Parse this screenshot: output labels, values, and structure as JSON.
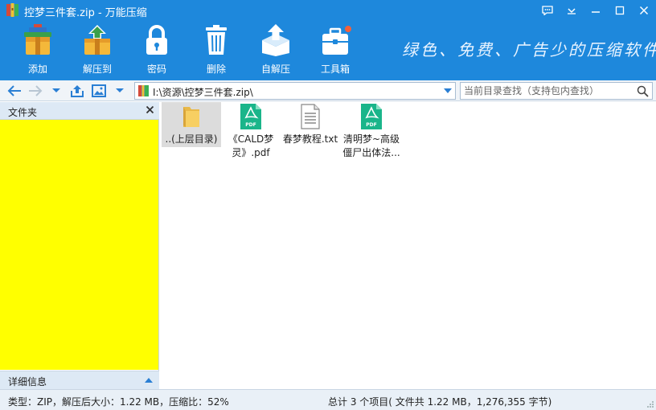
{
  "window": {
    "title": "控梦三件套.zip - 万能压缩",
    "app_icon": "archive-books-icon",
    "controls": [
      "feedback-icon",
      "menu-chevron-icon",
      "minimize-icon",
      "maximize-icon",
      "close-icon"
    ]
  },
  "toolbar": {
    "items": [
      {
        "label": "添加",
        "icon": "add-archive-icon"
      },
      {
        "label": "解压到",
        "icon": "extract-to-icon"
      },
      {
        "label": "密码",
        "icon": "lock-icon"
      },
      {
        "label": "删除",
        "icon": "trash-icon"
      },
      {
        "label": "自解压",
        "icon": "self-extract-icon"
      },
      {
        "label": "工具箱",
        "icon": "toolbox-icon"
      }
    ],
    "slogan": "绿色、免费、广告少的压缩软件"
  },
  "addressbar": {
    "path": "I:\\资源\\控梦三件套.zip\\",
    "search_placeholder": "当前目录查找（支持包内查找）"
  },
  "left_pane": {
    "folders_title": "文件夹",
    "details_title": "详细信息"
  },
  "files": [
    {
      "name": "..(上层目录)",
      "icon": "folder-icon",
      "selected": true
    },
    {
      "name": "《CALD梦灵》.pdf",
      "icon": "pdf-icon"
    },
    {
      "name": "春梦教程.txt",
      "icon": "text-file-icon"
    },
    {
      "name": "清明梦~高级僵尸出体法...",
      "icon": "pdf-icon"
    }
  ],
  "status": {
    "left": "类型：ZIP，解压后大小：1.22 MB，压缩比：52%",
    "right": "总计 3 个项目( 文件共 1.22 MB，1,276,355 字节)"
  },
  "colors": {
    "header_blue": "#1e88dc",
    "folder_pane_fill": "#ffff00",
    "pdf_green": "#1ab58a",
    "selection_gray": "#dcdcdc"
  }
}
